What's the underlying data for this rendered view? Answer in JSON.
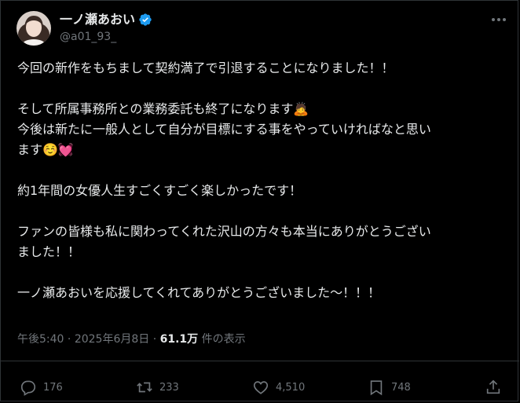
{
  "author": {
    "display_name": "一ノ瀬あおい",
    "handle": "@a01_93_",
    "verified": true,
    "avatar": "profile-photo"
  },
  "post": {
    "lines": [
      "今回の新作をもちまして契約満了で引退することになりました！！",
      "",
      "そして所属事務所との業務委託も終了になります🙇",
      "今後は新たに一般人として自分が目標にする事をやっていければなと思い",
      "ます☺️💓",
      "",
      "約1年間の女優人生すごくすごく楽しかったです！",
      "",
      "ファンの皆様も私に関わってくれた沢山の方々も本当にありがとうござい",
      "ました！！",
      "",
      "一ノ瀬あおいを応援してくれてありがとうございました〜！！！"
    ]
  },
  "meta": {
    "time": "午後5:40",
    "dot1": " · ",
    "date": "2025年6月8日",
    "dot2": " · ",
    "views": "61.1万",
    "views_label": " 件の表示"
  },
  "actions": {
    "replies": "176",
    "reposts": "233",
    "likes": "4,510",
    "bookmarks": "748"
  },
  "colors": {
    "background": "#000000",
    "text": "#e7e9ea",
    "muted": "#71767b",
    "verified": "#1d9bf0",
    "border": "#2f3336"
  }
}
